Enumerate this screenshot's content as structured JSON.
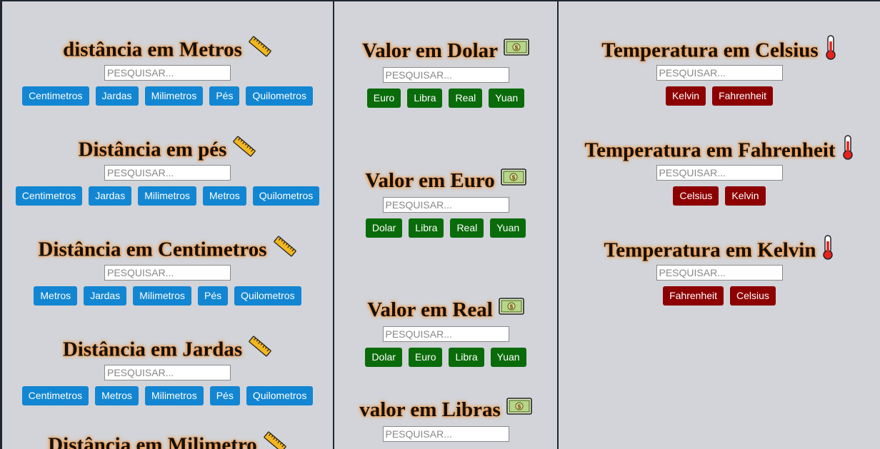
{
  "search_placeholder": "PESQUISAR...",
  "distance": [
    {
      "title": "distância em Metros",
      "buttons": [
        "Centimetros",
        "Jardas",
        "Milimetros",
        "Pés",
        "Quilometros"
      ]
    },
    {
      "title": "Distância em pés",
      "buttons": [
        "Centimetros",
        "Jardas",
        "Milimetros",
        "Metros",
        "Quilometros"
      ]
    },
    {
      "title": "Distância em Centimetros",
      "buttons": [
        "Metros",
        "Jardas",
        "Milimetros",
        "Pés",
        "Quilometros"
      ]
    },
    {
      "title": "Distância em Jardas",
      "buttons": [
        "Centimetros",
        "Metros",
        "Milimetros",
        "Pés",
        "Quilometros"
      ]
    },
    {
      "title": "Distância em Milimetro",
      "buttons": []
    }
  ],
  "currency": [
    {
      "title": "Valor em Dolar",
      "buttons": [
        "Euro",
        "Libra",
        "Real",
        "Yuan"
      ]
    },
    {
      "title": "Valor em Euro",
      "buttons": [
        "Dolar",
        "Libra",
        "Real",
        "Yuan"
      ]
    },
    {
      "title": "Valor em Real",
      "buttons": [
        "Dolar",
        "Euro",
        "Libra",
        "Yuan"
      ]
    },
    {
      "title": "valor em Libras",
      "buttons": []
    }
  ],
  "temperature": [
    {
      "title": "Temperatura em Celsius",
      "buttons": [
        "Kelvin",
        "Fahrenheit"
      ]
    },
    {
      "title": "Temperatura em Fahrenheit",
      "buttons": [
        "Celsius",
        "Kelvin"
      ]
    },
    {
      "title": "Temperatura em Kelvin",
      "buttons": [
        "Fahrenheit",
        "Celsius"
      ]
    }
  ],
  "colors": {
    "distance_button": "#1286d2",
    "currency_button": "#0a6b0a",
    "temperature_button": "#8c0000",
    "title_glow": "#ff8a1e",
    "panel_bg": "#d2d4d9"
  },
  "icons": {
    "distance": "ruler-icon",
    "currency": "banknote-icon",
    "temperature": "thermometer-icon"
  }
}
